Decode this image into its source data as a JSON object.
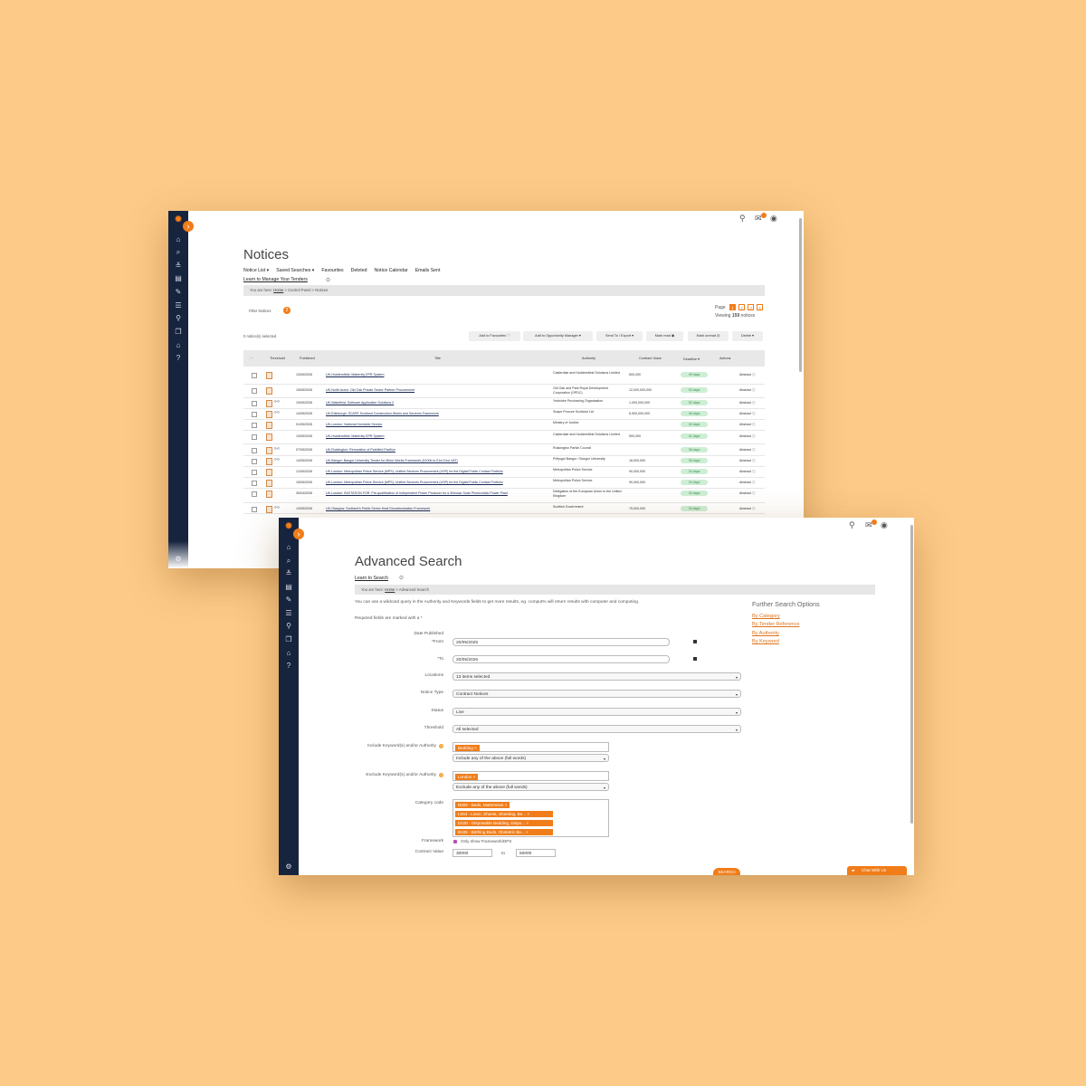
{
  "colors": {
    "background": "#fdca88",
    "sidebar": "#17243d",
    "accent": "#f07d1a",
    "deadline": "#cdeed4"
  },
  "icons": {
    "sidebar": [
      "home-icon",
      "search-doc-icon",
      "filter-icon",
      "notices-icon",
      "edit-icon",
      "list-icon",
      "search-icon",
      "documents-icon",
      "building-icon",
      "help-icon"
    ],
    "settings": "gear-icon",
    "top": [
      "search-icon",
      "mail-icon",
      "user-icon"
    ]
  },
  "notices": {
    "title": "Notices",
    "tabs": [
      "Notice List ▾",
      "Saved Searches ▾",
      "Favourites",
      "Deleted",
      "Notice Calendar",
      "Emails Sent"
    ],
    "learn_link": "Learn to Manage Your Tenders",
    "breadcrumb": {
      "prefix": "You are here:",
      "home": "Home",
      "rest": " > Control Panel > Notices"
    },
    "filter": {
      "label": "Filter Notices",
      "count": "2"
    },
    "pagination": {
      "label": "Page",
      "pages": [
        "1",
        "2",
        "3",
        "4"
      ],
      "current": "1",
      "viewing_prefix": "Viewing",
      "viewing_count": "159",
      "viewing_suffix": "notices"
    },
    "selected": "0 notice(s) selected",
    "actions": [
      "Add to Favourites ♡",
      "Add to Opportunity Manager ▾",
      "Send To / Export ▾",
      "Mark read ◉",
      "Mark unread ◎",
      "Delete ▾"
    ],
    "columns": [
      "···",
      "Threshold",
      "Published",
      "Title",
      "Authority",
      "Contract Value",
      "Deadline ▾",
      "Actions"
    ],
    "rows": [
      {
        "published": "13/05/2026",
        "title": "UK-Huddersfield: Maternity EPR System",
        "authority": "Calderdale and Huddersfield Solutions Limited",
        "value": "500,000",
        "deadline": "49 days",
        "action": "Abstract ⓘ",
        "tree": false
      },
      {
        "published": "15/05/2026",
        "title": "UK-North Acton: Old Oak Private Sector Partner Procurement",
        "authority": "Old Oak and Park Royal Development Corporation (OPDC)",
        "value": "12,000,000,000",
        "deadline": "53 days",
        "action": "Abstract ⓘ",
        "tree": false
      },
      {
        "published": "19/05/2026",
        "title": "UK-Wakefield: Software Application Solutions 2",
        "authority": "Yorkshire Purchasing Organisation",
        "value": "1,000,000,000",
        "deadline": "52 days",
        "action": "Abstract ⓘ",
        "tree": true
      },
      {
        "published": "14/05/2026",
        "title": "UK-Edinburgh: SCAPE Scotland Construction Works and Services Framework",
        "authority": "Scape Procure Scotland Ltd",
        "value": "6,900,000,000",
        "deadline": "45 days",
        "action": "Abstract ⓘ",
        "tree": true
      },
      {
        "published": "01/05/2026",
        "title": "UK-London: National Homicide Service",
        "authority": "Ministry of Justice",
        "value": "",
        "deadline": "40 days",
        "action": "Abstract ⓘ",
        "tree": false
      },
      {
        "published": "13/05/2026",
        "title": "UK-Huddersfield: Maternity EPR System",
        "authority": "Calderdale and Huddersfield Solutions Limited",
        "value": "500,000",
        "deadline": "41 days",
        "action": "Abstract ⓘ",
        "tree": false
      },
      {
        "published": "07/05/2026",
        "title": "UK-Ruskington: Renovation of Parkfield Pavilion",
        "authority": "Ruskington Parish Council",
        "value": "",
        "deadline": "38 days",
        "action": "Abstract ⓘ",
        "tree": true
      },
      {
        "published": "14/05/2026",
        "title": "UK-Bangor: Bangor University Tender for Minor Works Framework (£100k to £1m Excl VAT)",
        "authority": "Prifysgol Bangor / Bangor University",
        "value": "18,000,000",
        "deadline": "35 days",
        "action": "Abstract ⓘ",
        "tree": true
      },
      {
        "published": "12/05/2026",
        "title": "UK-London: Metropolitan Police Service (MPS): Unified Services Procurement (USP) for the Digital Public Contact Portfolio",
        "authority": "Metropolitan Police Service",
        "value": "90,000,000",
        "deadline": "34 days",
        "action": "Abstract ⓘ",
        "tree": false
      },
      {
        "published": "15/05/2026",
        "title": "UK-London: Metropolitan Police Service (MPS): Unified Services Procurement (USP) for the Digital Public Contact Portfolio",
        "authority": "Metropolitan Police Service",
        "value": "90,000,000",
        "deadline": "34 days",
        "action": "Abstract ⓘ",
        "tree": false
      },
      {
        "published": "30/04/2026",
        "title": "UK-London: INVITATION FOR: Pre-qualification of Independent Power Producer for a 30mwac Solar Photovoltaic Power Plant",
        "authority": "Delegation of the European Union to the United Kingdom",
        "value": "",
        "deadline": "33 days",
        "action": "Abstract ⓘ",
        "tree": false
      },
      {
        "published": "13/05/2026",
        "title": "UK-Glasgow: Scotland's Public Sector Heat Decarbonisation Framework",
        "authority": "Scottish Government",
        "value": "75,000,000",
        "deadline": "33 days",
        "action": "Abstract ⓘ",
        "tree": true
      }
    ]
  },
  "advanced": {
    "title": "Advanced Search",
    "learn_link": "Learn to Search",
    "breadcrumb": {
      "prefix": "You are here:",
      "home": "Home",
      "rest": " > Advanced Search"
    },
    "intro": "You can use a wildcard query in the Authority and Keywords fields to get more results, eg. comput% will return results with computer and computing.",
    "required": "Required fields are marked with a *",
    "date_published": "Date Published",
    "from_label": "*From",
    "from_value": "20/05/2025",
    "to_label": "*To",
    "to_value": "20/05/2026",
    "locations_label": "Locations",
    "locations_value": "13 items selected",
    "notice_type_label": "Notice Type",
    "notice_type_value": "Contract Notices",
    "status_label": "Status",
    "status_value": "Live",
    "threshold_label": "Threshold",
    "threshold_value": "All selected",
    "include_label": "Include Keyword(s) and/or Authority",
    "include_tag": "Bedding ×",
    "include_mode": "Include any of the above (full words)",
    "exclude_label": "Exclude Keyword(s) and/or Authority",
    "exclude_tag": "London ×",
    "exclude_mode": "Exclude any of the above (full words)",
    "category_label": "Category code",
    "categories": [
      "B009 - Beds, Mattresses ×",
      "L004 - Linen, Sheets, Sheeting, Be... ×",
      "D100 - Disposable Bedding, Dispo... ×",
      "B105 - Birthing Beds, Obstetric Be... ×"
    ],
    "framework_label": "Framework",
    "framework_check": "Only show Framework/DPS",
    "contract_label": "Contract Value",
    "contract_from": "30000",
    "contract_to_word": "to",
    "contract_to": "50000",
    "search_button": "SEARCH",
    "chat_button": "Chat With Us",
    "further_title": "Further Search Options",
    "further_links": [
      "By Category",
      "By Tender Reference",
      "By Authority",
      "By Keyword"
    ]
  }
}
